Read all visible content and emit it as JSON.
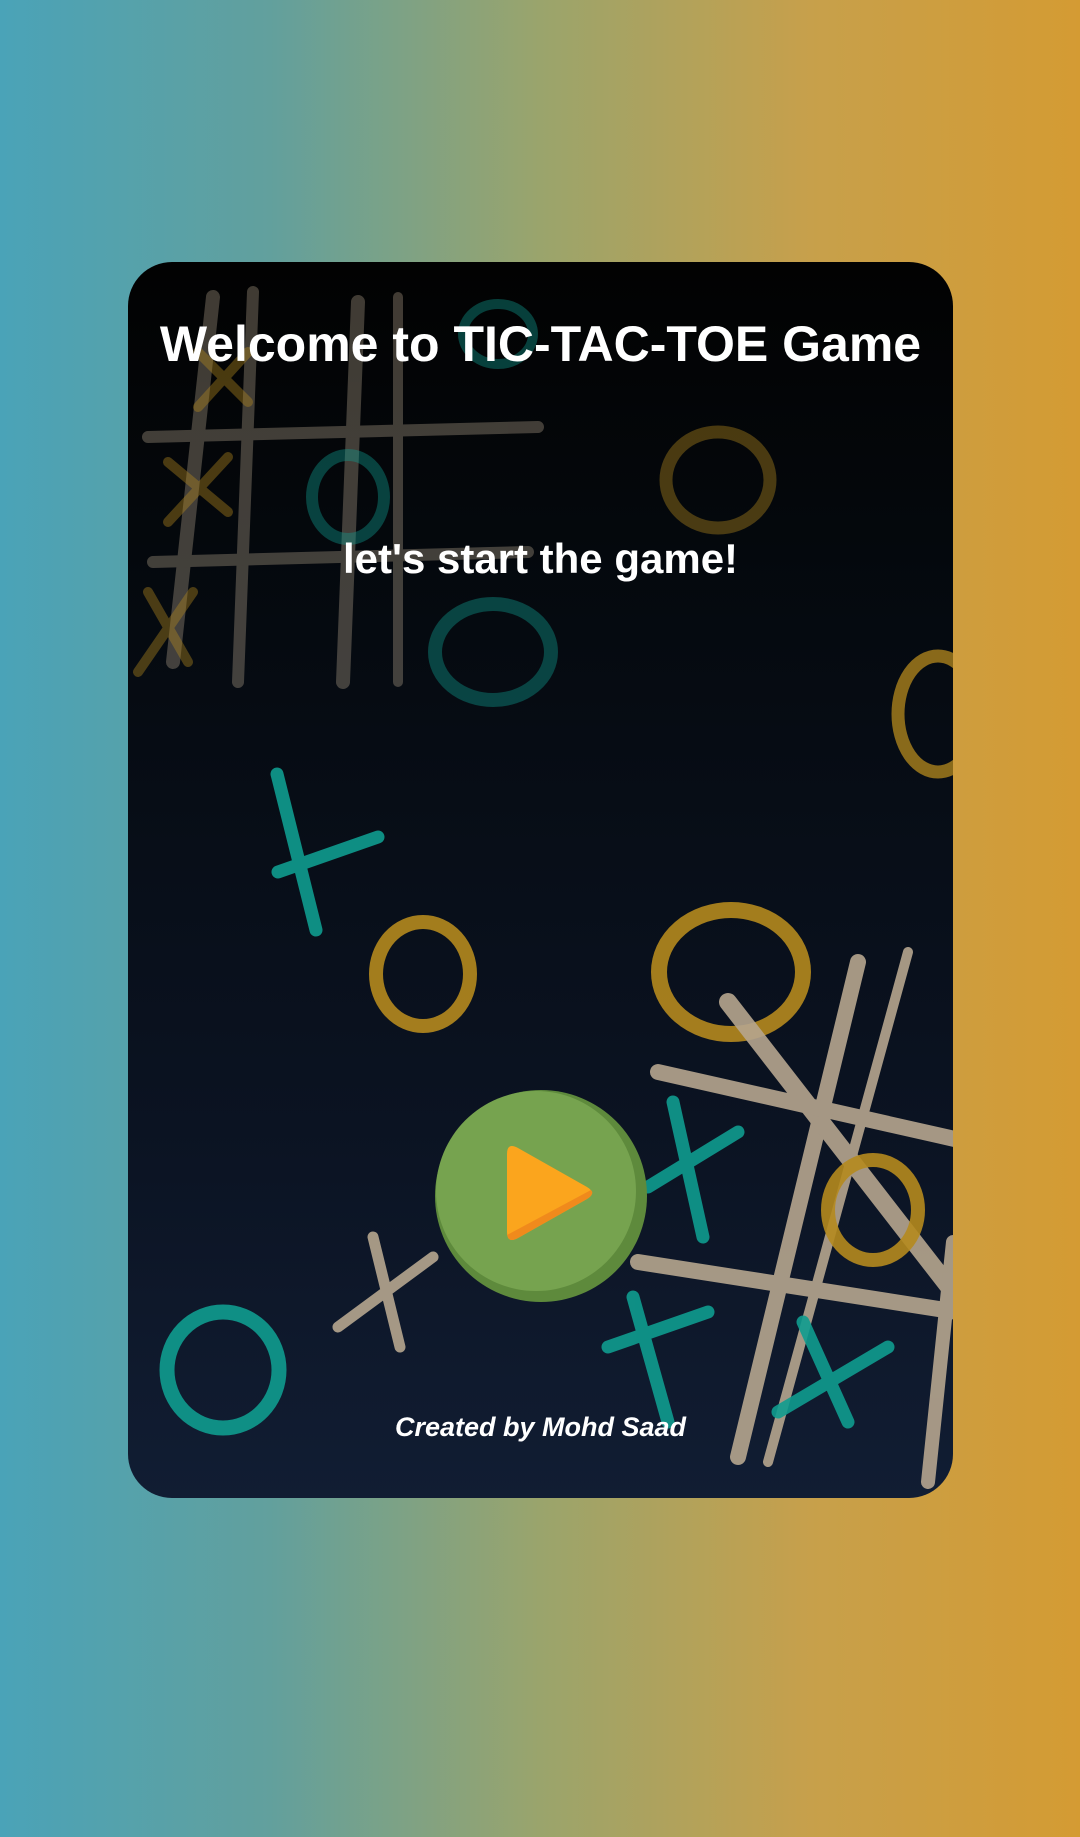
{
  "screen": {
    "title": "Welcome to TIC-TAC-TOE Game",
    "subtitle": "let's start the game!",
    "credit": "Created by Mohd Saad"
  },
  "play_button": {
    "icon": "play-icon"
  },
  "colors": {
    "background_left": "#4aa3b8",
    "background_right": "#d49b33",
    "card_top": "#020202",
    "card_bottom": "#111d33",
    "play_green": "#76a34f",
    "play_orange": "#fba51d",
    "mark_teal": "#0f9c8f",
    "mark_gold": "#b5891e",
    "mark_beige": "#b6a68f"
  }
}
